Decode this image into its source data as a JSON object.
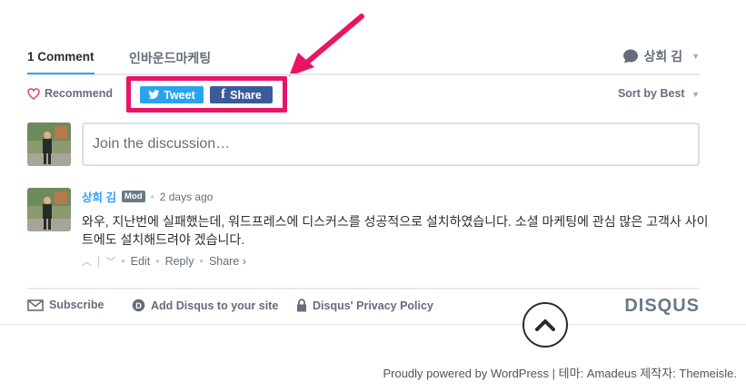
{
  "colors": {
    "accent_blue": "#2e9fff",
    "highlight_pink": "#ea1466",
    "twitter": "#2aa3ef",
    "facebook": "#3b5a9a",
    "text_muted": "#656c7a"
  },
  "nav": {
    "comment_count_tab": "1 Comment",
    "community_tab": "인바운드마케팅",
    "user_name": "상희 김",
    "user_icon": "speech-bubble-icon"
  },
  "toolbar": {
    "recommend_label": "Recommend",
    "recommend_icon": "heart-icon",
    "tweet_label": "Tweet",
    "share_label": "Share",
    "sort_label": "Sort by Best"
  },
  "composer": {
    "placeholder": "Join the discussion…"
  },
  "comments": [
    {
      "author": "상희 김",
      "badge": "Mod",
      "timestamp": "2 days ago",
      "text": "와우, 지난번에 실패했는데, 워드프레스에 디스커스를 성공적으로 설치하였습니다. 소셜 마케팅에 관심 많은 고객사 사이트에도 설치해드려야 겠습니다.",
      "actions": {
        "edit": "Edit",
        "reply": "Reply",
        "share": "Share ›"
      }
    }
  ],
  "footer": {
    "subscribe": "Subscribe",
    "add_disqus": "Add Disqus to your site",
    "privacy": "Disqus' Privacy Policy",
    "logo": "DISQUS"
  },
  "site_footer": {
    "text": "Proudly powered by WordPress | 테마: Amadeus 제작자: Themeisle."
  }
}
